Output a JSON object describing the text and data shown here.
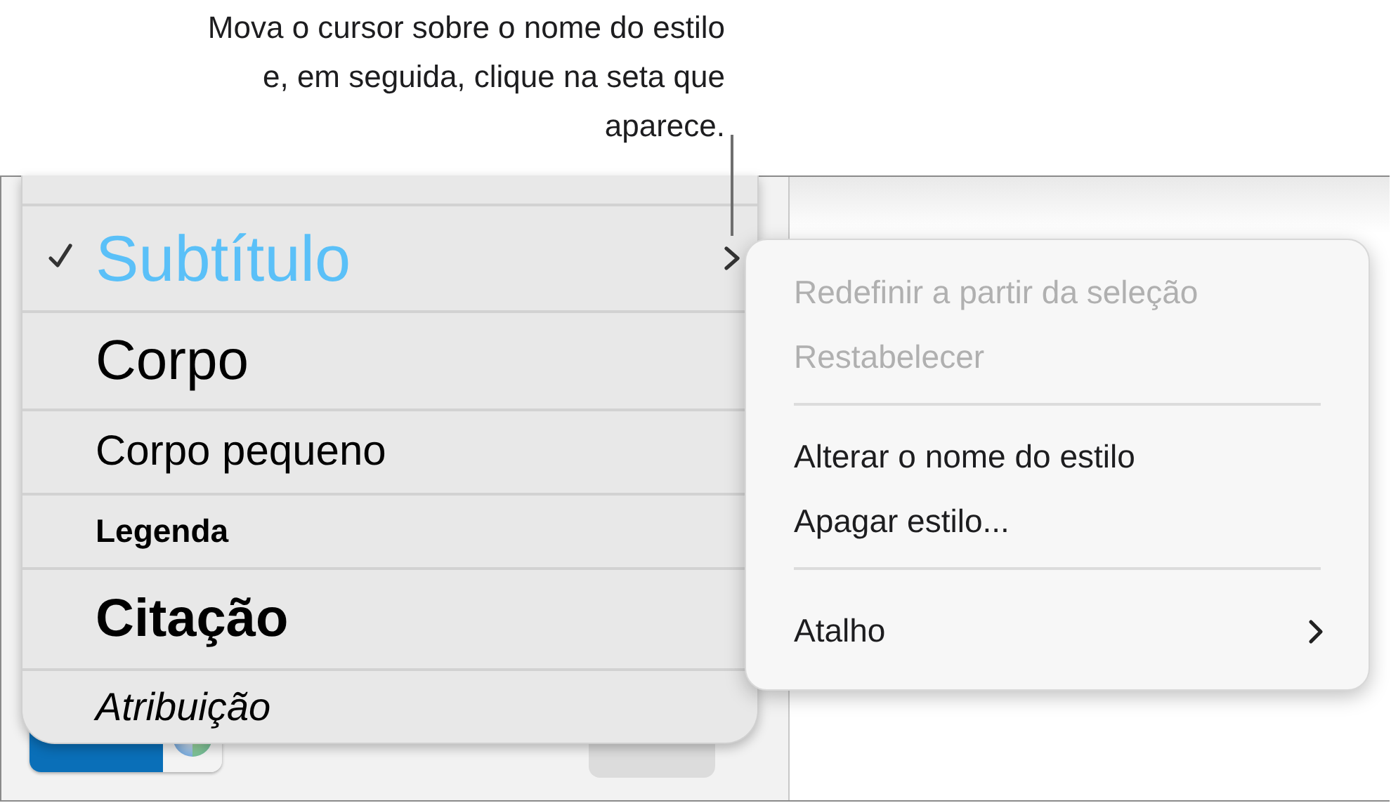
{
  "callout": {
    "text": "Mova o cursor sobre o nome do estilo e, em seguida, clique na seta que aparece."
  },
  "sidebar": {
    "color_well": {
      "kind": "gradient"
    }
  },
  "styles_menu": {
    "items": [
      {
        "label": "Subtítulo",
        "kind": "subtitle",
        "checked": true,
        "selected": true,
        "has_arrow": true
      },
      {
        "label": "Corpo",
        "kind": "body",
        "checked": false,
        "selected": false,
        "has_arrow": false
      },
      {
        "label": "Corpo pequeno",
        "kind": "small",
        "checked": false,
        "selected": false,
        "has_arrow": false
      },
      {
        "label": "Legenda",
        "kind": "caption",
        "checked": false,
        "selected": false,
        "has_arrow": false
      },
      {
        "label": "Citação",
        "kind": "quote",
        "checked": false,
        "selected": false,
        "has_arrow": false
      },
      {
        "label": "Atribuição",
        "kind": "attribution",
        "checked": false,
        "selected": false,
        "has_arrow": false
      }
    ]
  },
  "context_menu": {
    "items": [
      {
        "kind": "item",
        "label": "Redefinir a partir da seleção",
        "disabled": true
      },
      {
        "kind": "item",
        "label": "Restabelecer",
        "disabled": true
      },
      {
        "kind": "divider"
      },
      {
        "kind": "item",
        "label": "Alterar o nome do estilo",
        "disabled": false
      },
      {
        "kind": "item",
        "label": "Apagar estilo...",
        "disabled": false
      },
      {
        "kind": "divider"
      },
      {
        "kind": "submenu",
        "label": "Atalho",
        "disabled": false
      }
    ]
  }
}
